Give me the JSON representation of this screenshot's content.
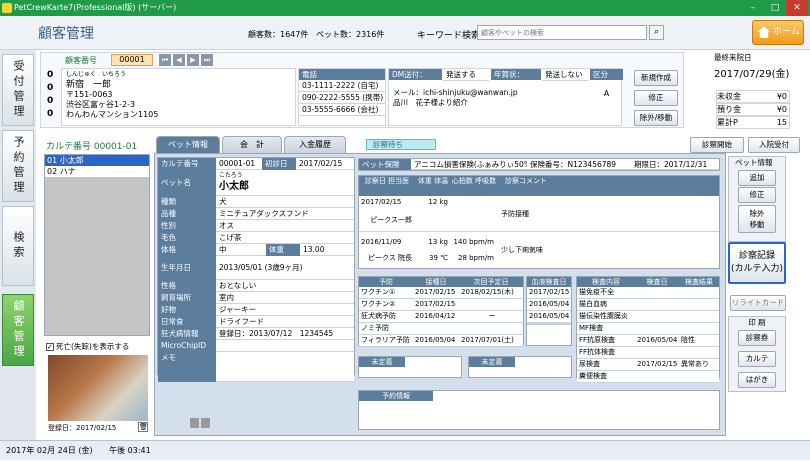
{
  "window": {
    "title": "PetCrewKarte7(Professional版) (サーバー)",
    "min": "–",
    "max": "□",
    "close": "✕"
  },
  "header": {
    "title": "顧客管理",
    "customer_count": "顧客数：1647件",
    "pet_count": "ペット数：2316件",
    "keyword_label": "キーワード検索",
    "search_placeholder": "顧客やペットの検索",
    "home_label": "ホーム"
  },
  "nav": [
    {
      "label": "受付管理"
    },
    {
      "label": "予約管理"
    },
    {
      "label": "検索"
    },
    {
      "label": "顧客管理"
    }
  ],
  "customer": {
    "number_label": "顧客番号",
    "number": "00001",
    "rows": [
      "0",
      "0",
      "0",
      "0"
    ],
    "kana": "しんじゅく　いちろう",
    "name": "新宿　一郎",
    "zip": "〒151-0063",
    "address1": "渋谷区富ヶ谷1-2-3",
    "address2": "わんわんマンション1105",
    "phone_label": "電話",
    "phone1": "03-1111-2222 (自宅)",
    "phone2": "090-2222-5555 (携帯)",
    "phone3": "03-5555-6666 (会社)",
    "dm_label": "DM送付：",
    "dm_value": "発送する",
    "nenga_label": "年賀状：",
    "nenga_value": "発送しない",
    "kubun_label": "区分",
    "kubun_value": "A",
    "mail": "メール：ichi-shinjuku@wanwan.jp",
    "intro": "品川　花子様より紹介"
  },
  "customer_buttons": {
    "new": "新規作成",
    "edit": "修正",
    "exclude": "除外/移動"
  },
  "visit": {
    "label": "最終来院日",
    "date": "2017/07/29(金)",
    "rows": [
      {
        "label": "未収金",
        "value": "¥0"
      },
      {
        "label": "預り金",
        "value": "¥0"
      },
      {
        "label": "累計P",
        "value": "15"
      }
    ]
  },
  "karte": {
    "label": "カルテ番号 00001-01",
    "pets": [
      "01 小太郎",
      "02 ハナ"
    ],
    "show_dead": "死亡(失踪)を表示する",
    "photo_date": "登録日：2017/02/15"
  },
  "tabs": [
    "ペット情報",
    "会　計",
    "入金履歴"
  ],
  "status_chip": "診察待ち",
  "top_buttons": {
    "start": "診察開始",
    "admit": "入院受付"
  },
  "pet": {
    "fields": [
      {
        "label": "カルテ番号",
        "value": "00001-01"
      },
      {
        "label": "ペット名",
        "value": "小太郎",
        "kana": "こたろう"
      },
      {
        "label": "種類",
        "value": "犬"
      },
      {
        "label": "品種",
        "value": "ミニチュアダックスフンド"
      },
      {
        "label": "性別",
        "value": "オス"
      },
      {
        "label": "毛色",
        "value": "こげ茶"
      },
      {
        "label": "体格",
        "value": "中"
      },
      {
        "label": "生年月日",
        "value": "2013/05/01 (3歳9ヶ月)"
      },
      {
        "label": "性格",
        "value": "おとなしい"
      },
      {
        "label": "飼育場所",
        "value": "室内"
      },
      {
        "label": "好物",
        "value": "ジャーキー"
      },
      {
        "label": "日常食",
        "value": "ドライフード"
      },
      {
        "label": "狂犬病情報",
        "value": "登録日：2013/07/12　1234545"
      },
      {
        "label": "MicroChipID",
        "value": ""
      },
      {
        "label": "メモ",
        "value": ""
      }
    ],
    "first_label": "初診日",
    "first_date": "2017/02/15",
    "weight_label": "体重",
    "weight": "13.00"
  },
  "insurance": {
    "label": "ペット保険",
    "name": "アニコム損害保険(ふぁみりぃ50%)",
    "number": "保険番号：N123456789",
    "expire": "期限日：2017/12/31"
  },
  "exam": {
    "headers": [
      "診察日\n担当医",
      "体重\n体温",
      "心拍数\n呼吸数",
      "診察コメント"
    ],
    "rows": [
      {
        "date": "2017/02/15",
        "doctor": "ピークス一郎",
        "weight": "12 kg",
        "temp": "",
        "hr": "",
        "rr": "",
        "comment": "予防接種"
      },
      {
        "date": "2016/11/09",
        "doctor": "ピークス 院長",
        "weight": "13 kg",
        "temp": "39 ℃",
        "hr": "140 bpm/m",
        "rr": "28 bpm/m",
        "comment": "少し下痢気味"
      }
    ]
  },
  "prevent": {
    "headers": [
      "予防",
      "接種日",
      "次回予定日"
    ],
    "rows": [
      [
        "ワクチン①",
        "2017/02/15",
        "2018/02/15(木)"
      ],
      [
        "ワクチン②",
        "2017/02/15",
        ""
      ],
      [
        "狂犬病予防",
        "2016/04/12",
        "ー"
      ],
      [
        "ノミ予防",
        "",
        ""
      ],
      [
        "フィラリア予防",
        "2016/05/04",
        "2017/07/01(土)"
      ]
    ]
  },
  "blood": {
    "header": "血液検査日",
    "rows": [
      "2017/02/15",
      "2016/05/04",
      "2016/05/04",
      "",
      ""
    ]
  },
  "tests": {
    "headers": [
      "検査内容",
      "検査日",
      "検査結果"
    ],
    "rows": [
      [
        "猫免疫不全",
        "",
        ""
      ],
      [
        "猫白血病",
        "",
        ""
      ],
      [
        "猫伝染性腹膜炎",
        "",
        ""
      ],
      [
        "MF検査",
        "",
        ""
      ],
      [
        "FF抗原検査",
        "2016/05/04",
        "陰性"
      ],
      [
        "FF抗体検査",
        "",
        ""
      ],
      [
        "尿検査",
        "2017/02/15",
        "異常あり"
      ],
      [
        "糞便検査",
        "",
        ""
      ]
    ]
  },
  "undefined1": "未定義",
  "undefined2": "未定義",
  "reserve": {
    "label": "予約情報"
  },
  "side": {
    "pet_info": "ペット情報",
    "add": "追加",
    "edit": "修正",
    "exclude": "除外\n移動",
    "record": "診察記録\n(カルテ入力)",
    "rehab": "リライトカード",
    "print": "印 刷",
    "ticket": "診察券",
    "karte": "カルテ",
    "postcard": "はがき"
  },
  "statusbar": {
    "date": "2017年 02月 24日 (金)",
    "time": "午後 03:41"
  },
  "colors": {
    "titlebar": "#1f9a46",
    "accent": "#5c7d9c",
    "orange": "#f5a623"
  }
}
